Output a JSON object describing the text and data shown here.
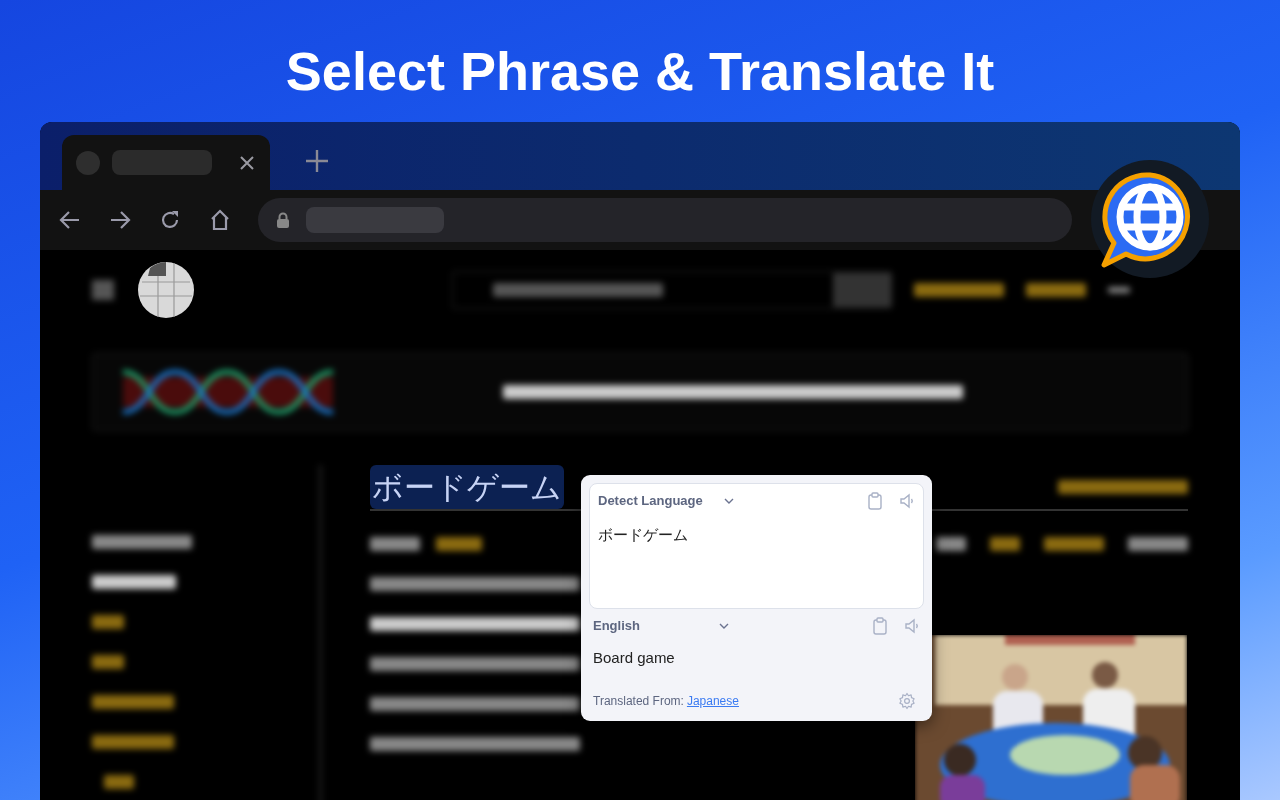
{
  "headline": "Select Phrase & Translate It",
  "page": {
    "heading": "ボードゲーム",
    "selected": true
  },
  "popup": {
    "source": {
      "language": "Detect Language",
      "text": "ボードゲーム"
    },
    "target": {
      "language": "English",
      "text": "Board game"
    },
    "footer": {
      "label": "Translated From:",
      "language": "Japanese"
    }
  }
}
